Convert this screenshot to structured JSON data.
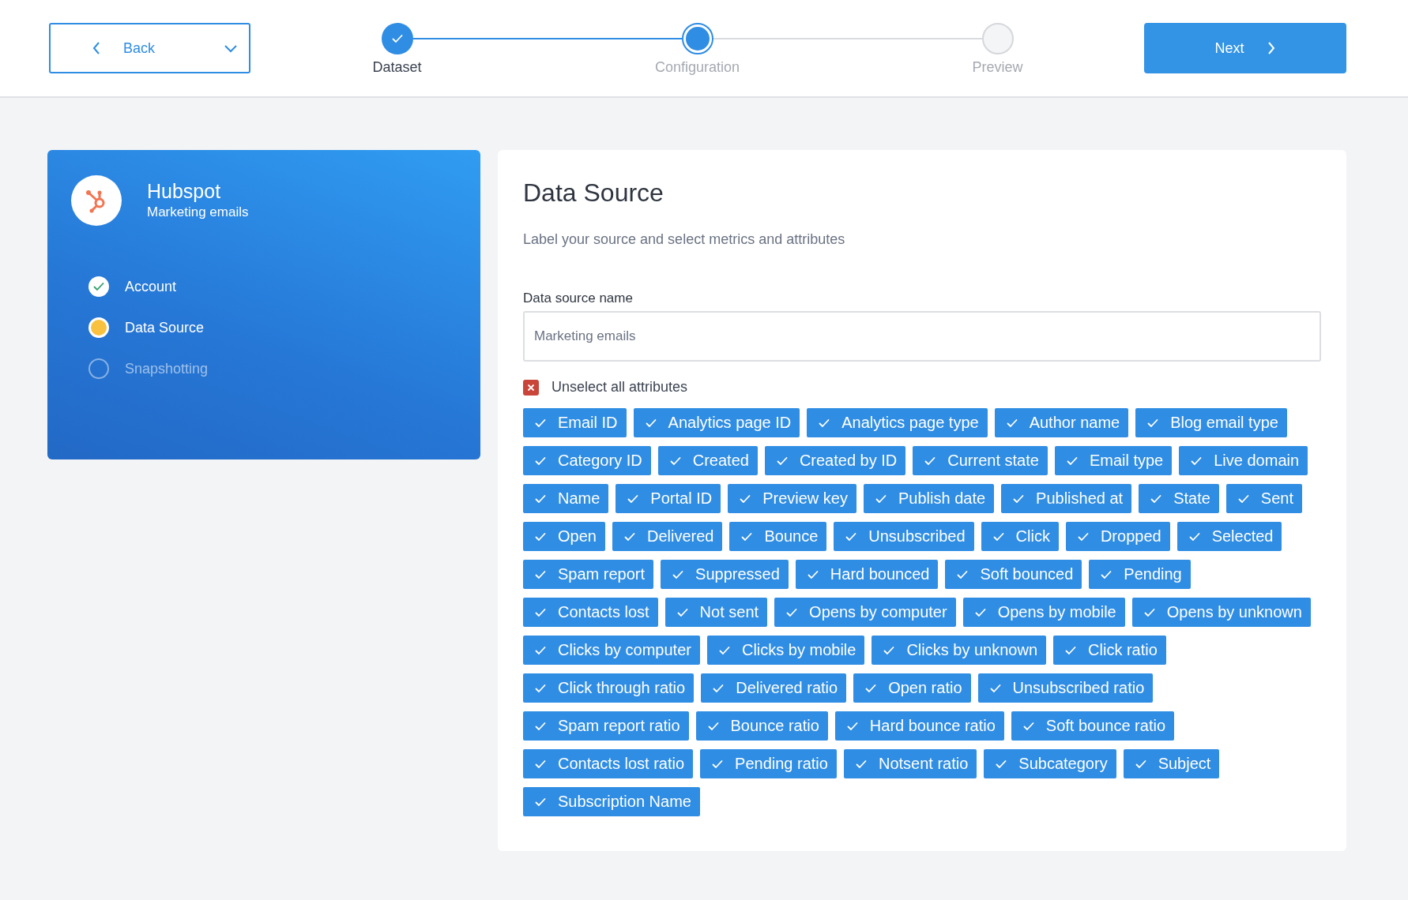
{
  "header": {
    "back_button": "Back",
    "steps": [
      {
        "label": "Dataset",
        "done": true,
        "selected": false
      },
      {
        "label": "Configuration",
        "done": false,
        "selected": true
      },
      {
        "label": "Preview",
        "done": false,
        "selected": false
      }
    ],
    "next_button": "Next"
  },
  "sidebar": {
    "title": "Hubspot",
    "subtitle": "Marketing emails",
    "items": [
      {
        "label": "Account",
        "done": true,
        "selected": false
      },
      {
        "label": "Data Source",
        "done": false,
        "selected": true
      },
      {
        "label": "Snapshotting",
        "done": false,
        "selected": false
      }
    ]
  },
  "form": {
    "title": "Data Source",
    "description": "Label your source and select metrics and attributes",
    "name_label": "Data source name",
    "name_value": "Marketing emails",
    "unselect_all": "Unselect all attributes",
    "unselect_all_checked": true,
    "attributes": [
      {
        "label": "Email ID",
        "checked": true
      },
      {
        "label": "Analytics page ID",
        "checked": true
      },
      {
        "label": "Analytics page type",
        "checked": true
      },
      {
        "label": "Author name",
        "checked": true
      },
      {
        "label": "Blog email type",
        "checked": true
      },
      {
        "label": "Category ID",
        "checked": true
      },
      {
        "label": "Created",
        "checked": true
      },
      {
        "label": "Created by ID",
        "checked": true
      },
      {
        "label": "Current state",
        "checked": true
      },
      {
        "label": "Email type",
        "checked": true
      },
      {
        "label": "Live domain",
        "checked": true
      },
      {
        "label": "Name",
        "checked": true
      },
      {
        "label": "Portal ID",
        "checked": true
      },
      {
        "label": "Preview key",
        "checked": true
      },
      {
        "label": "Publish date",
        "checked": true
      },
      {
        "label": "Published at",
        "checked": true
      },
      {
        "label": "State",
        "checked": true
      },
      {
        "label": "Sent",
        "checked": true
      },
      {
        "label": "Open",
        "checked": true
      },
      {
        "label": "Delivered",
        "checked": true
      },
      {
        "label": "Bounce",
        "checked": true
      },
      {
        "label": "Unsubscribed",
        "checked": true
      },
      {
        "label": "Click",
        "checked": true
      },
      {
        "label": "Dropped",
        "checked": true
      },
      {
        "label": "Selected",
        "checked": true
      },
      {
        "label": "Spam report",
        "checked": true
      },
      {
        "label": "Suppressed",
        "checked": true
      },
      {
        "label": "Hard bounced",
        "checked": true
      },
      {
        "label": "Soft bounced",
        "checked": true
      },
      {
        "label": "Pending",
        "checked": true
      },
      {
        "label": "Contacts lost",
        "checked": true
      },
      {
        "label": "Not sent",
        "checked": true
      },
      {
        "label": "Opens by computer",
        "checked": true
      },
      {
        "label": "Opens by mobile",
        "checked": true
      },
      {
        "label": "Opens by unknown",
        "checked": true
      },
      {
        "label": "Clicks by computer",
        "checked": true
      },
      {
        "label": "Clicks by mobile",
        "checked": true
      },
      {
        "label": "Clicks by unknown",
        "checked": true
      },
      {
        "label": "Click ratio",
        "checked": true
      },
      {
        "label": "Click through ratio",
        "checked": true
      },
      {
        "label": "Delivered ratio",
        "checked": true
      },
      {
        "label": "Open ratio",
        "checked": true
      },
      {
        "label": "Unsubscribed ratio",
        "checked": true
      },
      {
        "label": "Spam report ratio",
        "checked": true
      },
      {
        "label": "Bounce ratio",
        "checked": true
      },
      {
        "label": "Hard bounce ratio",
        "checked": true
      },
      {
        "label": "Soft bounce ratio",
        "checked": true
      },
      {
        "label": "Contacts lost ratio",
        "checked": true
      },
      {
        "label": "Pending ratio",
        "checked": true
      },
      {
        "label": "Notsent ratio",
        "checked": true
      },
      {
        "label": "Subcategory",
        "checked": true
      },
      {
        "label": "Subject",
        "checked": true
      },
      {
        "label": "Subscription Name",
        "checked": true
      }
    ]
  }
}
